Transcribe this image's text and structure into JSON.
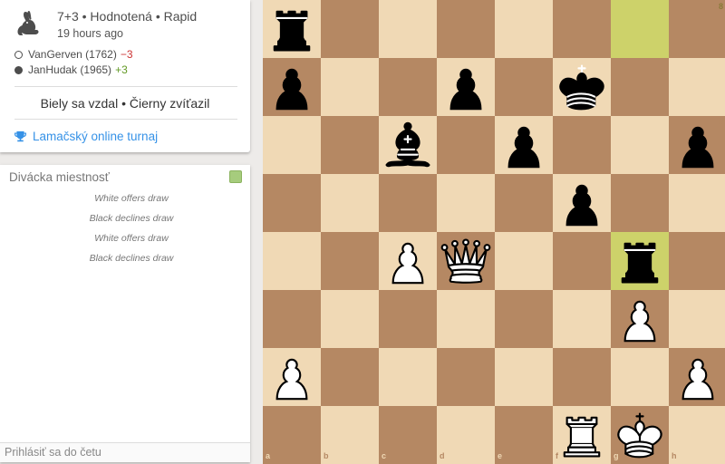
{
  "game": {
    "summary": "7+3 • Hodnotená • Rapid",
    "time_ago": "19 hours ago",
    "white_player": "VanGerven (1762)",
    "white_rating_diff": "−3",
    "black_player": "JanHudak (1965)",
    "black_rating_diff": "+3",
    "result": "Biely sa vzdal • Čierny zvíťazil",
    "tournament": "Lamačský online turnaj",
    "speed_icon": "rabbit-icon",
    "tournament_icon": "trophy-icon"
  },
  "chat": {
    "title": "Divácka miestnosť",
    "messages": [
      "White offers draw",
      "Black declines draw",
      "White offers draw",
      "Black declines draw"
    ],
    "input_placeholder": "Prihlásiť sa do četu"
  },
  "board": {
    "files": [
      "a",
      "b",
      "c",
      "d",
      "e",
      "f",
      "g",
      "h"
    ],
    "ranks": [
      "8",
      "7",
      "6",
      "5",
      "4",
      "3",
      "2",
      "1"
    ],
    "last_move_squares": [
      "g8",
      "g4"
    ],
    "pieces": [
      {
        "square": "a8",
        "piece": "bR"
      },
      {
        "square": "a7",
        "piece": "bP"
      },
      {
        "square": "d7",
        "piece": "bP"
      },
      {
        "square": "f7",
        "piece": "bK"
      },
      {
        "square": "c6",
        "piece": "bB"
      },
      {
        "square": "e6",
        "piece": "bP"
      },
      {
        "square": "h6",
        "piece": "bP"
      },
      {
        "square": "f5",
        "piece": "bP"
      },
      {
        "square": "c4",
        "piece": "wP"
      },
      {
        "square": "d4",
        "piece": "wQ"
      },
      {
        "square": "g4",
        "piece": "bR"
      },
      {
        "square": "g3",
        "piece": "wP"
      },
      {
        "square": "a2",
        "piece": "wP"
      },
      {
        "square": "h2",
        "piece": "wP"
      },
      {
        "square": "f1",
        "piece": "wR"
      },
      {
        "square": "g1",
        "piece": "wK"
      }
    ],
    "colors": {
      "light": "#f0d9b5",
      "dark": "#b58863",
      "highlight": "#cdd26a"
    }
  }
}
